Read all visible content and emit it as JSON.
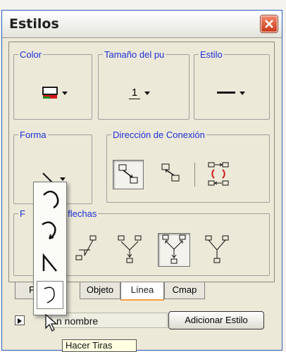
{
  "window": {
    "title": "Estilos"
  },
  "groups": {
    "color": "Color",
    "size": "Tamaño del pu",
    "style": "Estilo",
    "shape": "Forma",
    "direction": "Dirección de Conexión",
    "arrows": "las flechas",
    "arrows_prefix": "F"
  },
  "controls": {
    "size_value": "1",
    "color_icon": "color-swatch-icon",
    "style_icon": "solid-line-icon",
    "shape_icon": "straight-line-icon"
  },
  "tabs": [
    {
      "label": "F",
      "active": false
    },
    {
      "label": "Objeto",
      "active": false
    },
    {
      "label": "Línea",
      "active": true
    },
    {
      "label": "Cmap",
      "active": false
    }
  ],
  "bottom": {
    "name_value": "n nombre",
    "add_button": "Adicionar Estilo"
  },
  "shape_menu": {
    "items": [
      "arc-curve-icon",
      "curve-arrow-icon",
      "elbow-line-icon",
      "loop-curve-icon"
    ],
    "selected_index": 3
  },
  "tooltip": "Hacer Tiras",
  "colors": {
    "legend": "#1c2fd6",
    "swatch_top": "#1a1a1a",
    "swatch_bottom": "#d21818",
    "tab_accent": "#f6a03c"
  }
}
